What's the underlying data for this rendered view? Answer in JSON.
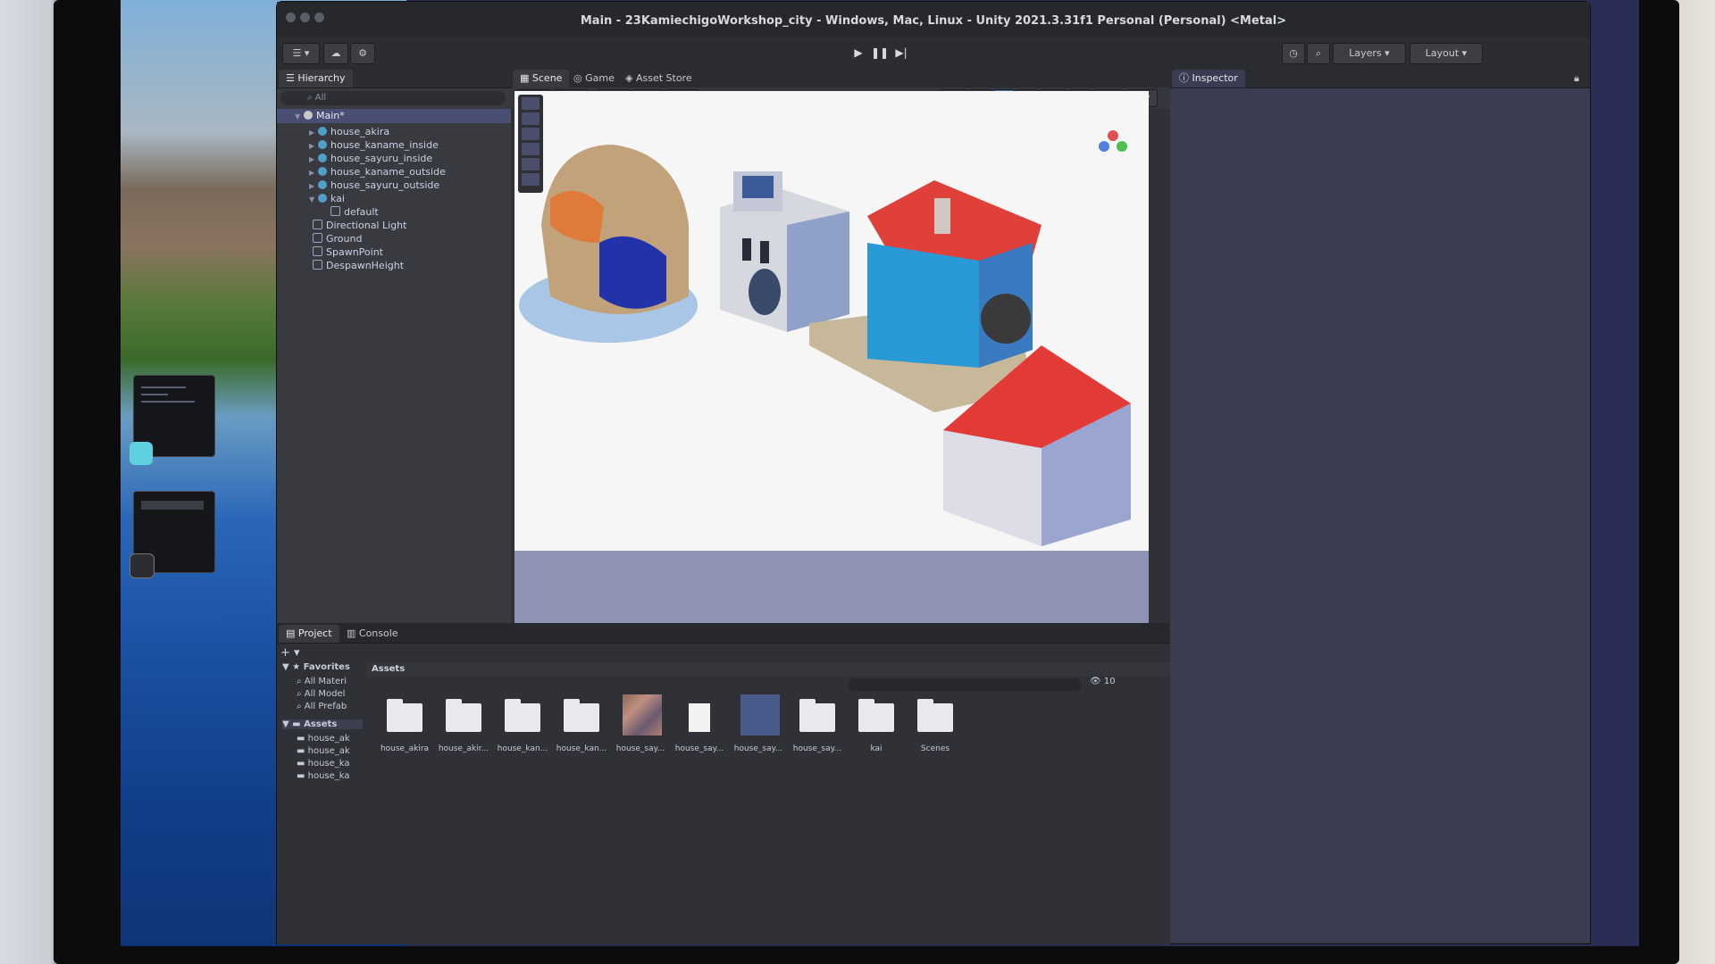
{
  "window": {
    "title": "Main - 23KamiechigoWorkshop_city - Windows, Mac, Linux - Unity 2021.3.31f1 Personal (Personal) <Metal>"
  },
  "toolbar": {
    "layers_label": "Layers",
    "layout_label": "Layout"
  },
  "hierarchy": {
    "tab_label": "Hierarchy",
    "search_placeholder": "All",
    "root": "Main*",
    "items": [
      {
        "label": "house_akira",
        "icon": "prefab-sphere-icon"
      },
      {
        "label": "house_kaname_inside",
        "icon": "prefab-sphere-icon"
      },
      {
        "label": "house_sayuru_inside",
        "icon": "prefab-sphere-icon"
      },
      {
        "label": "house_kaname_outside",
        "icon": "prefab-sphere-icon"
      },
      {
        "label": "house_sayuru_outside",
        "icon": "prefab-sphere-icon"
      },
      {
        "label": "kai",
        "icon": "prefab-sphere-icon"
      },
      {
        "label": "default",
        "icon": "cube-icon"
      },
      {
        "label": "Directional Light",
        "icon": "cube-icon"
      },
      {
        "label": "Ground",
        "icon": "cube-icon"
      },
      {
        "label": "SpawnPoint",
        "icon": "cube-icon"
      },
      {
        "label": "DespawnHeight",
        "icon": "cube-icon"
      }
    ]
  },
  "center_tabs": {
    "scene": "Scene",
    "game": "Game",
    "asset_store": "Asset Store"
  },
  "inspector": {
    "tab_label": "Inspector"
  },
  "bottom_tabs": {
    "project": "Project",
    "console": "Console"
  },
  "project": {
    "favorites_label": "Favorites",
    "favorites": [
      "All Materi",
      "All Model",
      "All Prefab"
    ],
    "assets_root": "Assets",
    "asset_tree": [
      "house_ak",
      "house_ak",
      "house_ka",
      "house_ka"
    ],
    "breadcrumb": "Assets",
    "count": "10",
    "assets": [
      {
        "label": "house_akira",
        "kind": "folder"
      },
      {
        "label": "house_akir...",
        "kind": "folder"
      },
      {
        "label": "house_kan...",
        "kind": "folder"
      },
      {
        "label": "house_kan...",
        "kind": "folder"
      },
      {
        "label": "house_say...",
        "kind": "texture"
      },
      {
        "label": "house_say...",
        "kind": "file"
      },
      {
        "label": "house_say...",
        "kind": "prefab"
      },
      {
        "label": "house_say...",
        "kind": "folder"
      },
      {
        "label": "kai",
        "kind": "folder"
      },
      {
        "label": "Scenes",
        "kind": "folder"
      }
    ]
  }
}
